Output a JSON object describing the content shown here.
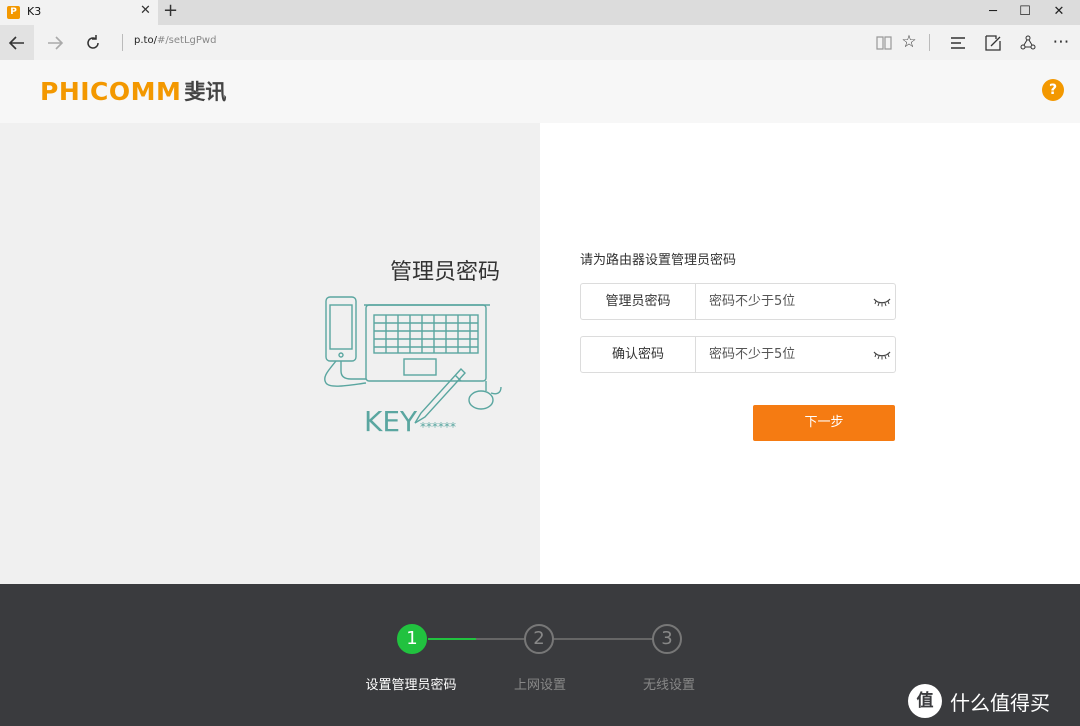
{
  "browser": {
    "tab_title": "K3",
    "tab_favicon": "P",
    "tab_close": "✕",
    "new_tab": "+",
    "address_host": "p.to/",
    "address_path": "#/setLgPwd",
    "icons": [
      "back-icon",
      "forward-icon",
      "refresh-icon",
      "reading-view-icon",
      "favorite-star-icon",
      "hub-icon",
      "web-note-icon",
      "share-icon",
      "more-icon"
    ]
  },
  "header": {
    "logo_en": "PHICOMM",
    "logo_cn": "斐讯",
    "help_label": "?",
    "brand_color": "#f39800"
  },
  "left": {
    "title": "管理员密码",
    "illustration_key": "KEY",
    "illustration_mask": "******",
    "illustration_color": "#5aa6a0"
  },
  "form": {
    "title": "请为路由器设置管理员密码",
    "fields": [
      {
        "label": "管理员密码",
        "placeholder": "密码不少于5位"
      },
      {
        "label": "确认密码",
        "placeholder": "密码不少于5位"
      }
    ],
    "next_label": "下一步",
    "next_color": "#f57b12"
  },
  "steps": {
    "items": [
      {
        "number": "1",
        "label": "设置管理员密码",
        "active": true
      },
      {
        "number": "2",
        "label": "上网设置",
        "active": false
      },
      {
        "number": "3",
        "label": "无线设置",
        "active": false
      }
    ],
    "active_color": "#21c23f"
  },
  "watermark": {
    "badge": "值",
    "text": "什么值得买"
  }
}
